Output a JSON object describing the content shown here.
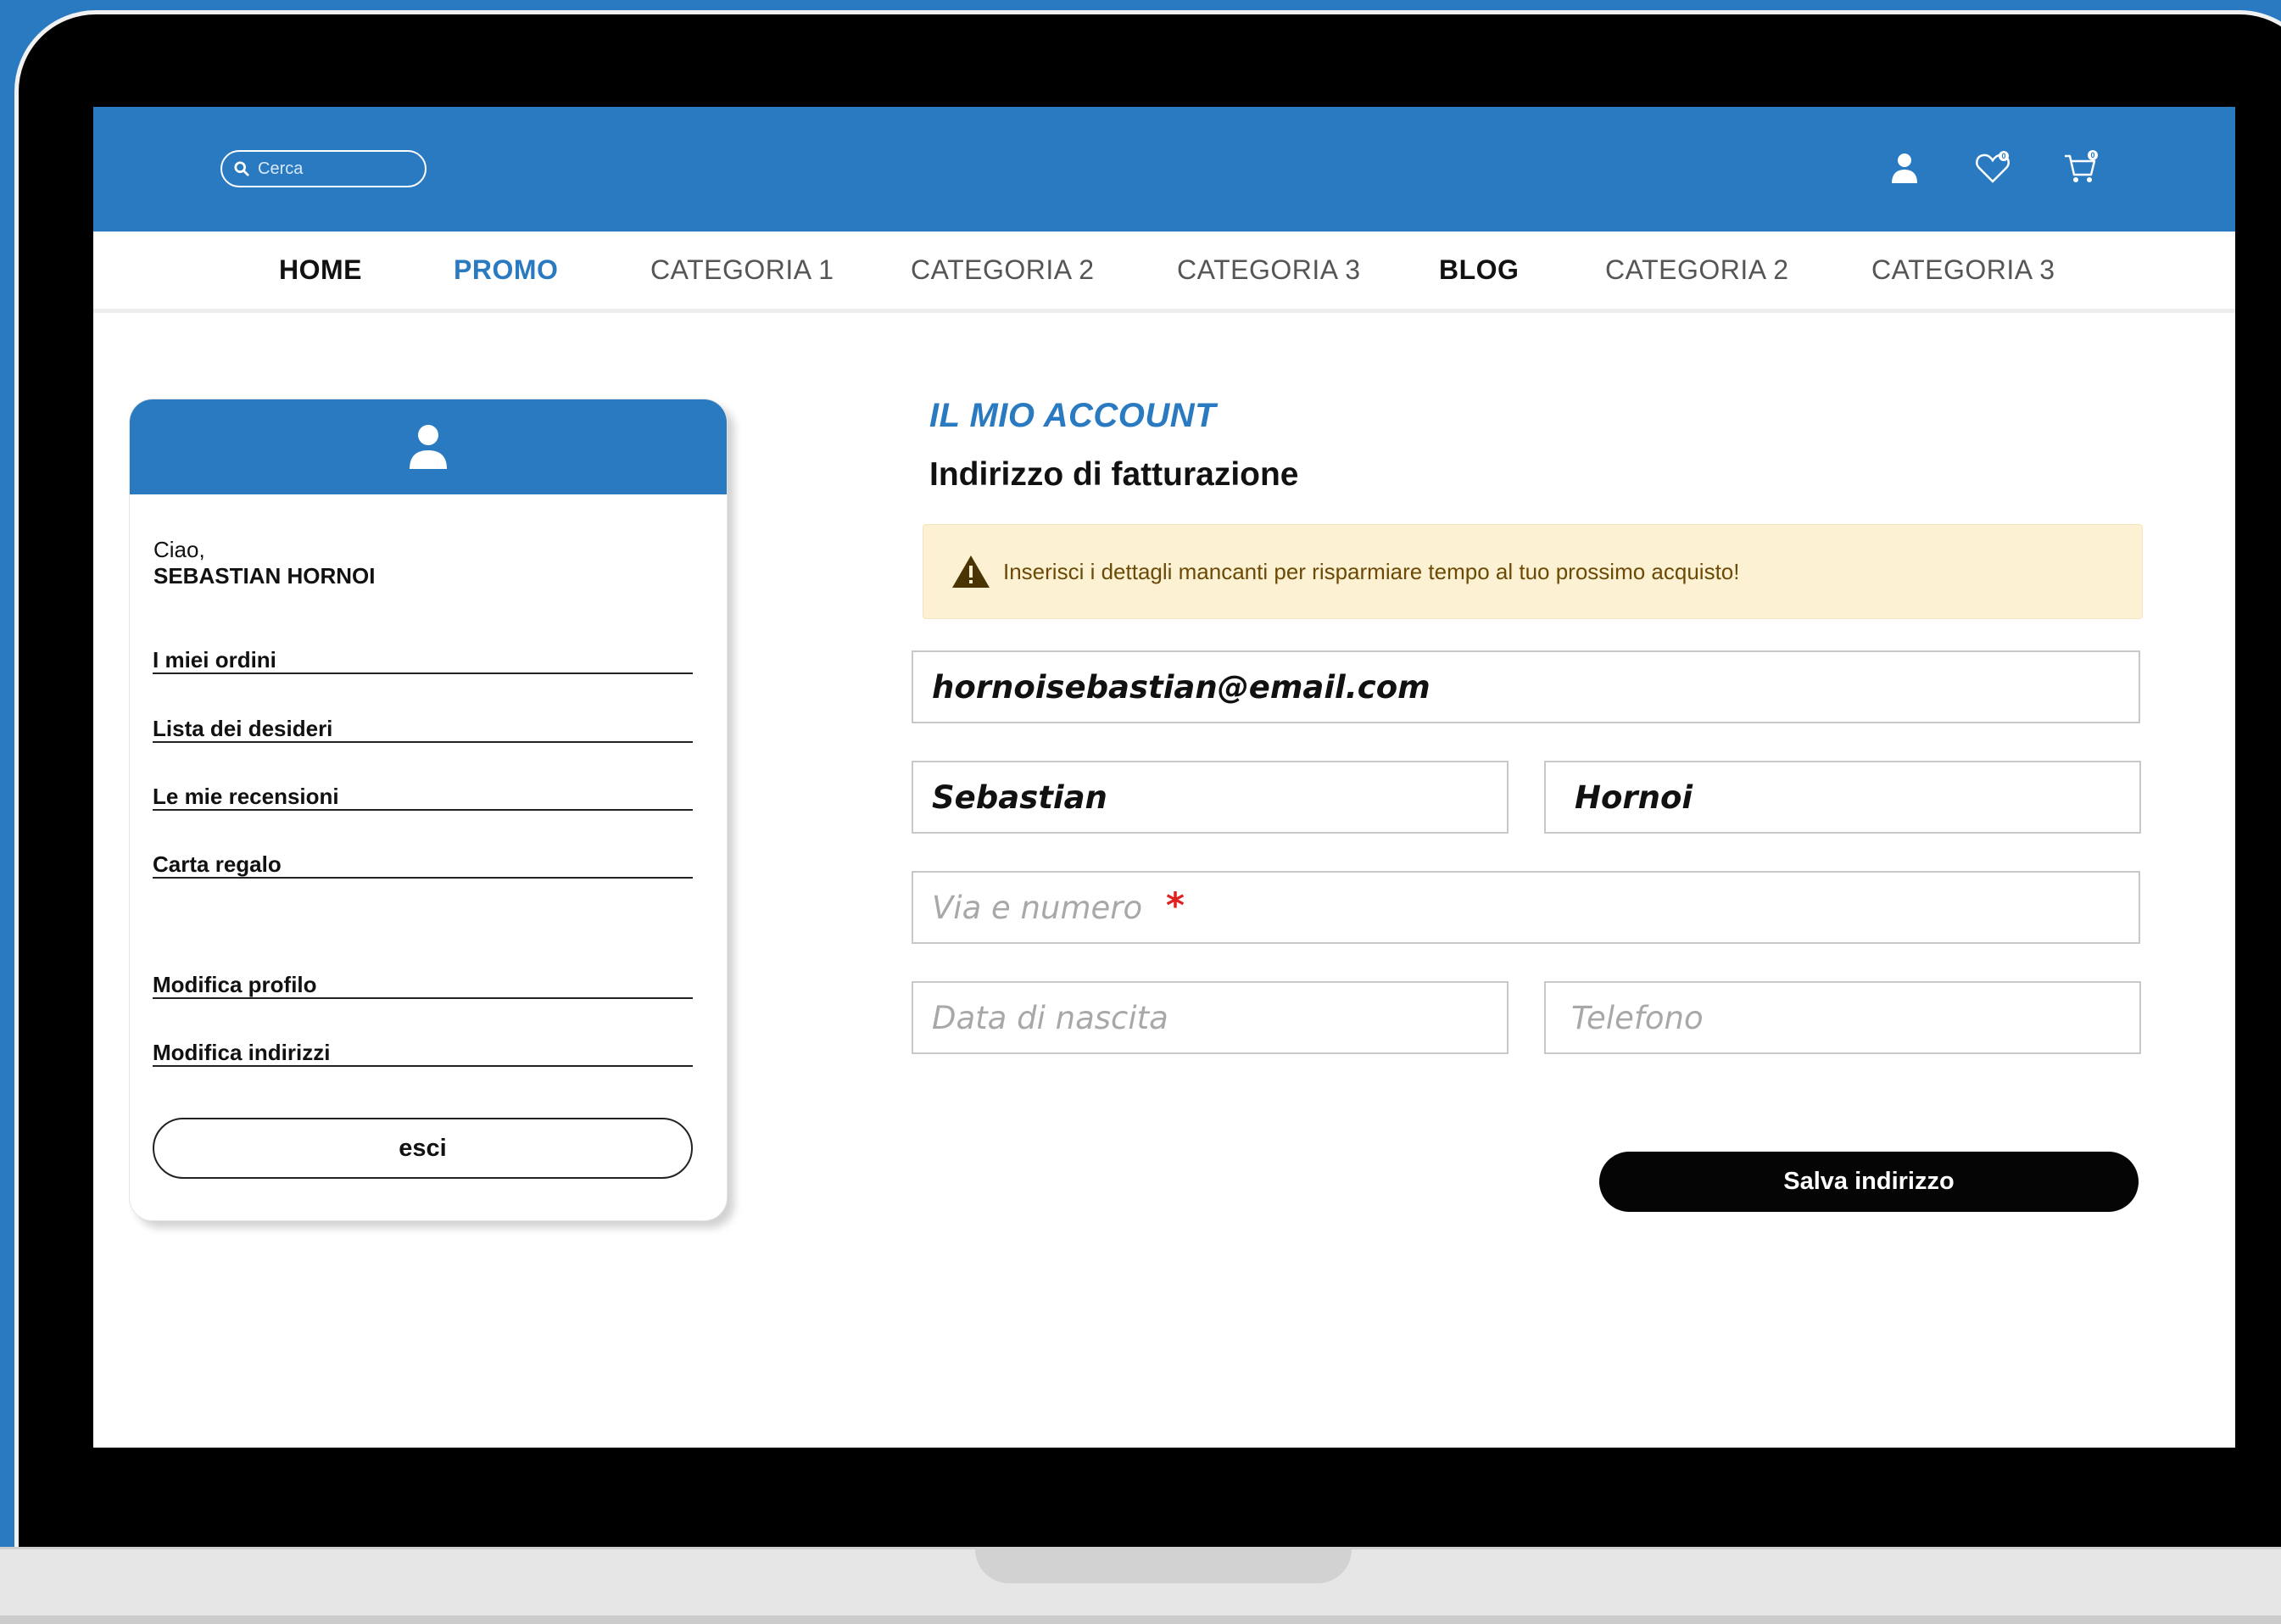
{
  "header": {
    "search_placeholder": "Cerca",
    "icons": [
      "user-icon",
      "heart-icon",
      "cart-icon"
    ],
    "wishlist_count": "0",
    "cart_count": "0"
  },
  "nav": {
    "items": [
      "HOME",
      "PROMO",
      "CATEGORIA 1",
      "CATEGORIA 2",
      "CATEGORIA 3",
      "BLOG",
      "CATEGORIA 2",
      "CATEGORIA 3"
    ]
  },
  "account_card": {
    "greeting": "Ciao,",
    "user_name": "SEBASTIAN HORNOI",
    "links": [
      "I miei ordini",
      "Lista dei desideri",
      "Le mie recensioni",
      "Carta regalo",
      "Modifica profilo",
      "Modifica indirizzi"
    ],
    "logout_label": "esci"
  },
  "form": {
    "kicker": "IL MIO ACCOUNT",
    "title": "Indirizzo di fatturazione",
    "alert_text": "Inserisci i dettagli mancanti per risparmiare tempo al tuo prossimo acquisto!",
    "email": "hornoisebastian@email.com",
    "first_name": "Sebastian",
    "last_name": "Hornoi",
    "street_placeholder": "Via e numero",
    "required_mark": "*",
    "birthdate_placeholder": "Data di nascita",
    "phone_placeholder": "Telefono",
    "save_label": "Salva indirizzo"
  },
  "colors": {
    "brand_blue": "#2a7ac2",
    "alert_bg": "#fdf1d4",
    "required_red": "#e02020"
  }
}
